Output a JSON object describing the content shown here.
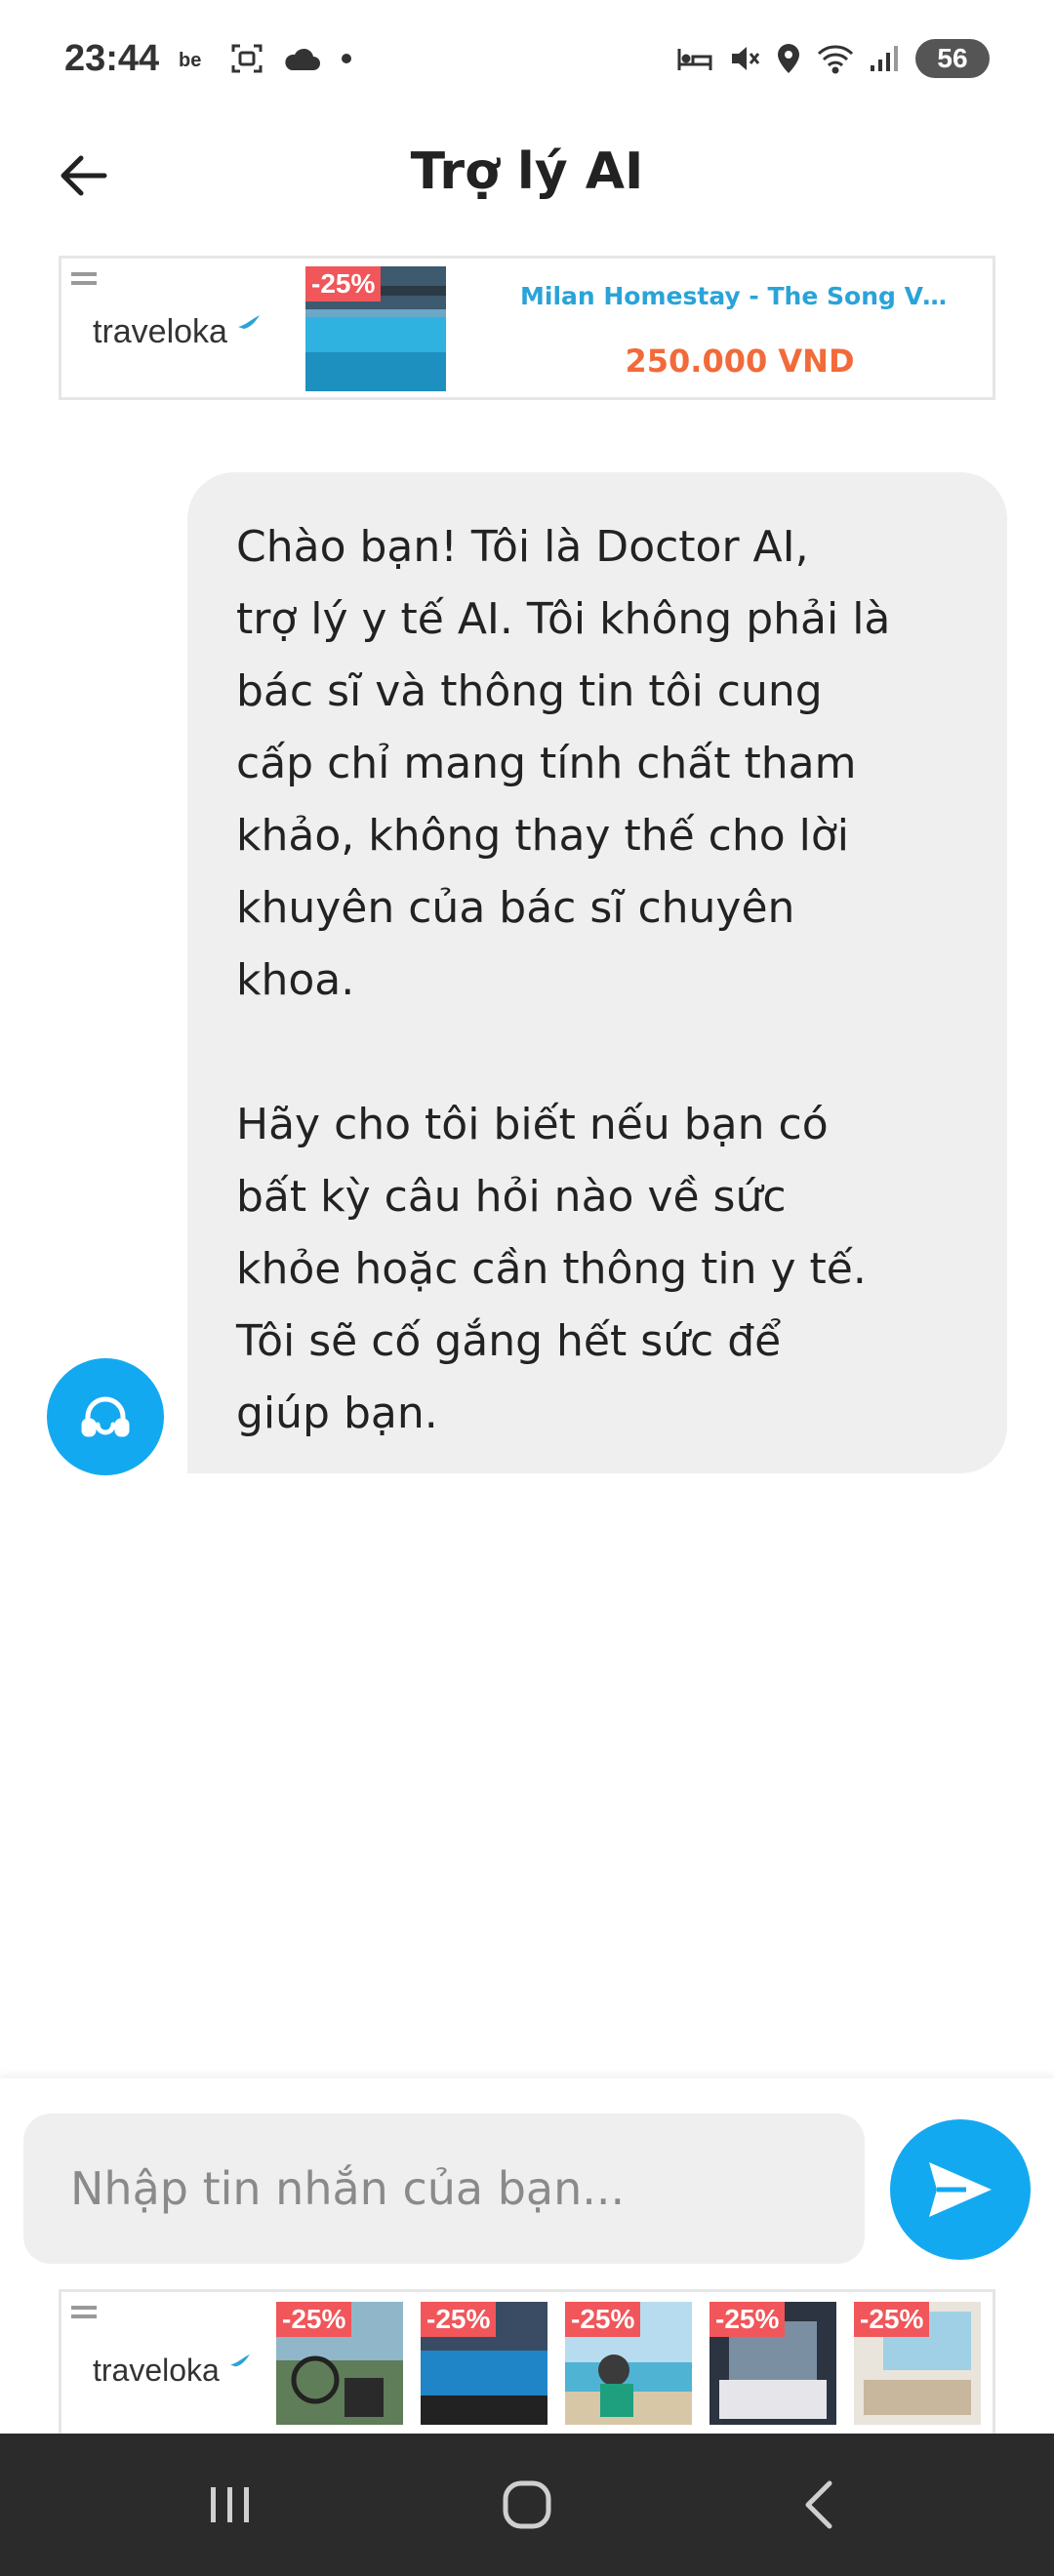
{
  "status_bar": {
    "time": "23:44",
    "notification_icons": [
      "be-icon",
      "screenshot-icon",
      "cloud-icon",
      "dot-icon"
    ],
    "system_icons": [
      "bed-icon",
      "mute-icon",
      "location-icon",
      "wifi-icon",
      "signal-icon"
    ],
    "battery": "56"
  },
  "header": {
    "title": "Trợ lý AI",
    "back_icon": "arrow-left-icon"
  },
  "ad_top": {
    "brand": "traveloka",
    "discount": "-25%",
    "title": "Milan Homestay - The Song Vu...",
    "price": "250.000 VND"
  },
  "chat": {
    "messages": [
      {
        "sender": "assistant",
        "text": "Chào bạn! Tôi là Doctor AI,\ntrợ lý y tế AI. Tôi không phải là\nbác sĩ và thông tin tôi cung\ncấp chỉ mang tính chất tham\nkhảo, không thay thế cho lời\nkhuyên của bác sĩ chuyên\nkhoa.\n\nHãy cho tôi biết nếu bạn có\nbất kỳ câu hỏi nào về sức\nkhỏe hoặc cần thông tin y tế.\nTôi sẽ cố gắng hết sức để\ngiúp bạn."
      }
    ],
    "avatar_icon": "headset-icon"
  },
  "composer": {
    "placeholder": "Nhập tin nhắn của bạn...",
    "value": "",
    "send_icon": "send-icon"
  },
  "ad_bottom": {
    "brand": "traveloka",
    "items": [
      {
        "discount": "-25%"
      },
      {
        "discount": "-25%"
      },
      {
        "discount": "-25%"
      },
      {
        "discount": "-25%"
      },
      {
        "discount": "-25%"
      }
    ]
  },
  "nav_bar": {
    "buttons": [
      "recents-icon",
      "home-icon",
      "back-icon"
    ]
  },
  "colors": {
    "accent": "#13a9f0",
    "bubble": "#efefef",
    "discount": "#f0565a",
    "price": "#f26a3a",
    "ad_title": "#2aa3d8"
  }
}
